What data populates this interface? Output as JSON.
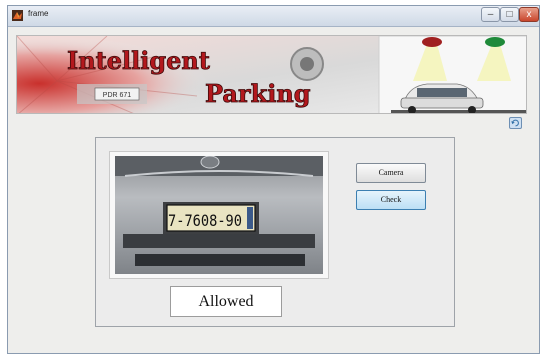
{
  "window": {
    "title": "frame",
    "minimize_glyph": "–",
    "maximize_glyph": "□",
    "close_glyph": "x"
  },
  "banner": {
    "line1": "Intelligent",
    "line2": "Parking",
    "plate_text": "PDR 671"
  },
  "image": {
    "plate_text": "7-7608-90"
  },
  "buttons": {
    "camera_label": "Camera",
    "check_label": "Check"
  },
  "status": {
    "text": "Allowed"
  },
  "colors": {
    "banner_text": "#b3181d",
    "check_accent": "#3c7fb1"
  }
}
